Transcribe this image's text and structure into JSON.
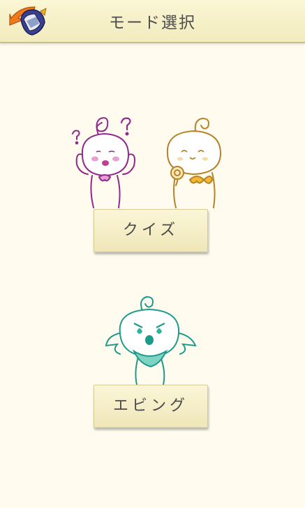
{
  "header": {
    "title": "モード選択",
    "back_icon": "helmet-back-icon"
  },
  "modes": [
    {
      "label": "クイズ"
    },
    {
      "label": "エビング"
    }
  ],
  "colors": {
    "background": "#fffcef",
    "header": "#f2ebbe",
    "pink_character": "#8f2a8c",
    "yellow_character": "#b5822a",
    "teal_character": "#1d9a8a"
  }
}
